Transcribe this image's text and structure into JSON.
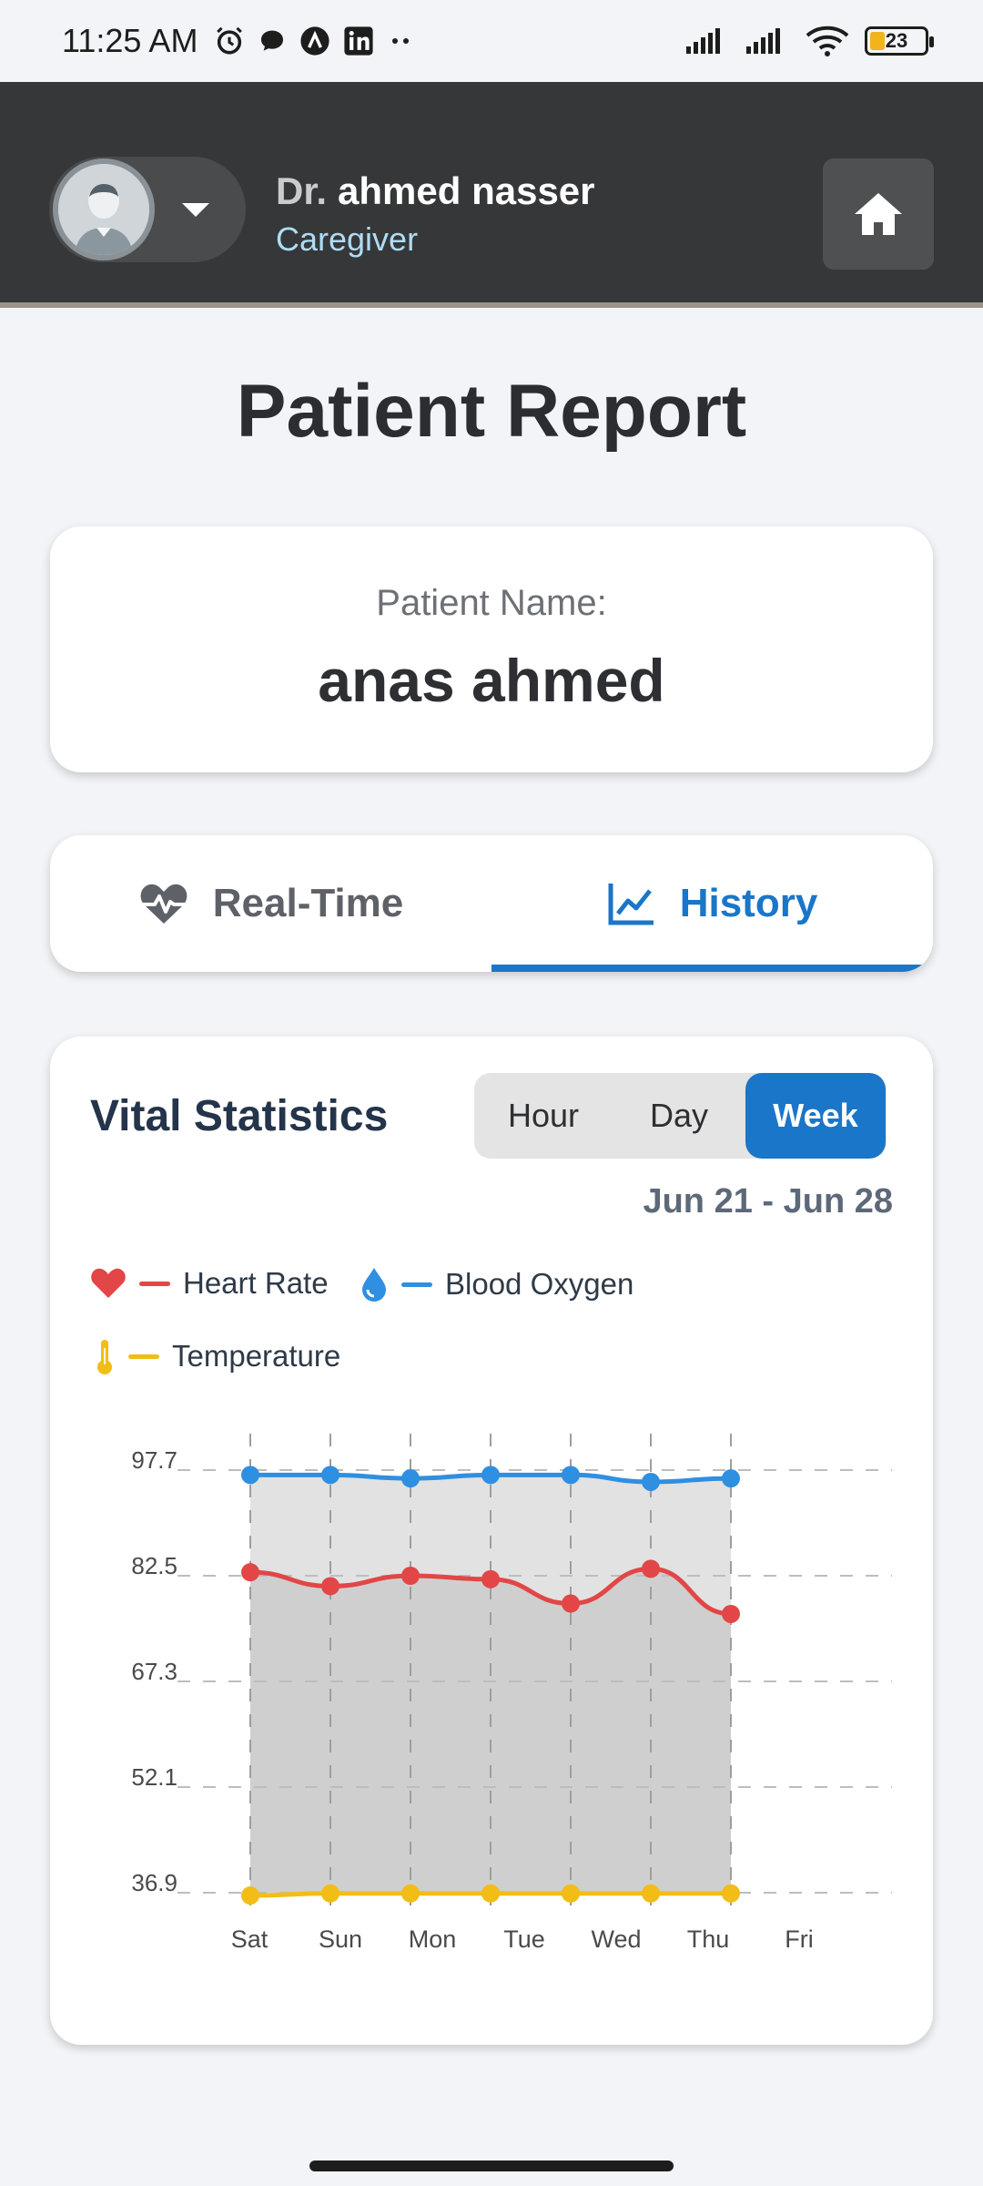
{
  "status_bar": {
    "time": "11:25 AM",
    "battery": "23",
    "icons": [
      "alarm-icon",
      "chat-icon",
      "app-a-icon",
      "linkedin-icon",
      "more-dots-icon",
      "signal-icon",
      "signal-icon",
      "wifi-icon",
      "battery-icon"
    ]
  },
  "header": {
    "doctor_prefix": "Dr.",
    "doctor_name": "ahmed nasser",
    "role": "Caregiver",
    "icons": [
      "avatar",
      "chevron-down-icon",
      "home-icon"
    ]
  },
  "page": {
    "title": "Patient Report"
  },
  "patient": {
    "label": "Patient Name:",
    "name": "anas ahmed"
  },
  "tabs": [
    {
      "label": "Real-Time",
      "icon": "heartbeat-icon",
      "active": false
    },
    {
      "label": "History",
      "icon": "line-chart-icon",
      "active": true
    }
  ],
  "stats": {
    "title": "Vital Statistics",
    "ranges": [
      "Hour",
      "Day",
      "Week"
    ],
    "selected_range": "Week",
    "date_range": "Jun 21 - Jun 28",
    "legend": [
      {
        "label": "Heart Rate",
        "icon": "heart-icon",
        "color": "#e24646"
      },
      {
        "label": "Blood Oxygen",
        "icon": "drop-icon",
        "color": "#2f8fe0"
      },
      {
        "label": "Temperature",
        "icon": "thermometer-icon",
        "color": "#f2bd16"
      }
    ]
  },
  "chart_data": {
    "type": "line",
    "categories": [
      "Sat",
      "Sun",
      "Mon",
      "Tue",
      "Wed",
      "Thu",
      "Fri"
    ],
    "y_ticks": [
      "97.7",
      "82.5",
      "67.3",
      "52.1",
      "36.9"
    ],
    "ylim": [
      36.9,
      97.7
    ],
    "grid": true,
    "legend_position": "top-left",
    "series": [
      {
        "name": "Heart Rate",
        "color": "#e24646",
        "values": [
          83,
          81,
          82.5,
          82,
          78.5,
          83.5,
          77
        ]
      },
      {
        "name": "Blood Oxygen",
        "color": "#2f8fe0",
        "values": [
          97,
          97,
          96.5,
          97,
          97,
          96,
          96.5
        ]
      },
      {
        "name": "Temperature",
        "color": "#f2bd16",
        "values": [
          36.5,
          36.8,
          36.8,
          36.8,
          36.8,
          36.8,
          36.8
        ]
      }
    ]
  }
}
